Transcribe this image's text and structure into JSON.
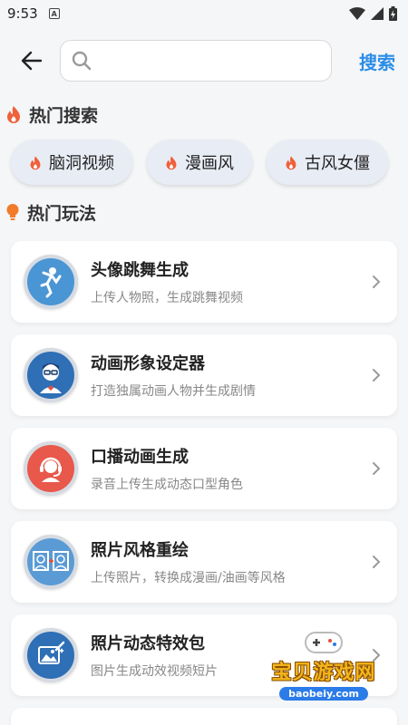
{
  "status": {
    "time": "9:53",
    "notif_letter": "A"
  },
  "search": {
    "placeholder": "",
    "value": "",
    "button_label": "搜索"
  },
  "hot_search": {
    "title": "热门搜索",
    "chips": [
      {
        "label": "脑洞视频"
      },
      {
        "label": "漫画风"
      },
      {
        "label": "古风女僵"
      }
    ]
  },
  "hot_play": {
    "title": "热门玩法",
    "items": [
      {
        "title": "头像跳舞生成",
        "subtitle": "上传人物照，生成跳舞视频",
        "icon": "dancing-person-icon"
      },
      {
        "title": "动画形象设定器",
        "subtitle": "打造独属动画人物并生成剧情",
        "icon": "cartoon-avatar-icon"
      },
      {
        "title": "口播动画生成",
        "subtitle": "录音上传生成动态口型角色",
        "icon": "headset-speaker-icon"
      },
      {
        "title": "照片风格重绘",
        "subtitle": "上传照片，转换成漫画/油画等风格",
        "icon": "photo-convert-icon"
      },
      {
        "title": "照片动态特效包",
        "subtitle": "图片生成动效视频短片",
        "icon": "magic-photo-icon"
      }
    ]
  },
  "watermark": {
    "text": "宝贝游戏网",
    "url": "baobeiy.com"
  },
  "colors": {
    "accent": "#2b8de8",
    "flame": "#f0603a"
  }
}
